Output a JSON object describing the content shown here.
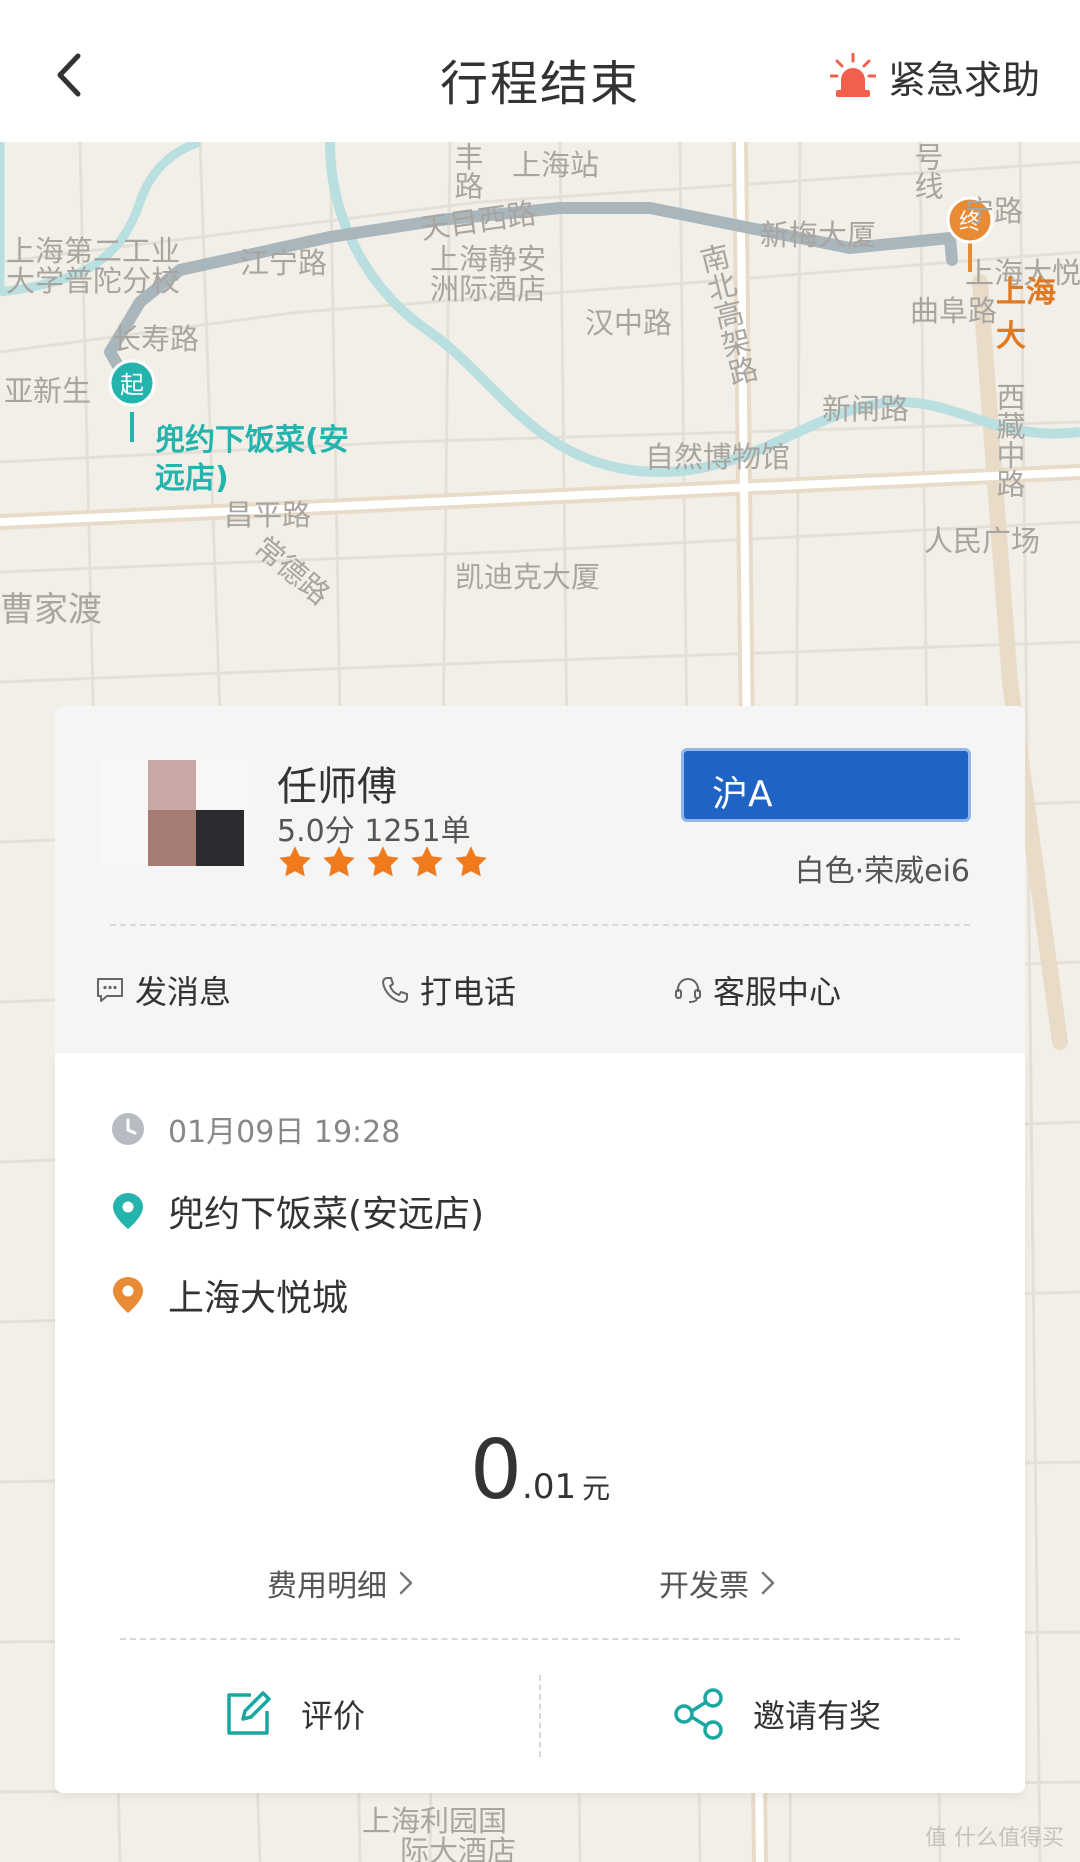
{
  "header": {
    "back_icon": "chevron-left-icon",
    "title": "行程结束",
    "sos_label": "紧急求助",
    "sos_icon": "alarm-light-icon",
    "sos_color": "#f25f4c"
  },
  "map": {
    "start_marker_glyph": "起",
    "end_marker_glyph": "终",
    "start_poi": [
      "兜约下饭菜(安",
      "远店)"
    ],
    "end_poi": "上海大",
    "start_color": "#24b4ad",
    "end_color": "#e98b34",
    "route_color": "#a9b7bd",
    "labels": {
      "l1": "上海第二工业",
      "l2": "大学普陀分校",
      "l3": "江宁路",
      "l4": "天目西路",
      "l5": "上海静安",
      "l6": "洲际酒店",
      "l7": "新梅大厦",
      "l8": "长寿路",
      "l9": "亚新生",
      "l10": "汉中路",
      "l11": "南北高架路",
      "l12": "曲阜路",
      "l13": "新闸路",
      "l14": "自然博物馆",
      "l15": "西藏中路",
      "l16": "人民广场",
      "l17": "昌平路",
      "l18": "常德路",
      "l19": "凯迪克大厦",
      "l20": "曹家渡",
      "l21": "上海利园国",
      "l22": "际大酒店",
      "l23": "宁路",
      "l24": "上海大悦",
      "l25": "号线",
      "l26": "丰路",
      "l27": "上海站"
    }
  },
  "driver": {
    "name": "任师傅",
    "stats": "5.0分 1251单",
    "rating": 5,
    "star_color": "#f07a1e",
    "plate": "沪A",
    "plate_color": "#1f64c4",
    "car": "白色·荣威ei6"
  },
  "actions": {
    "message": "发消息",
    "message_icon": "chat-bubble-icon",
    "call": "打电话",
    "call_icon": "phone-icon",
    "service": "客服中心",
    "service_icon": "headset-icon"
  },
  "trip": {
    "time": "01月09日 19:28",
    "time_icon": "clock-icon",
    "start": "兜约下饭菜(安远店)",
    "end": "上海大悦城"
  },
  "fare": {
    "integer": "0",
    "decimal": ".01",
    "unit": "元",
    "details_label": "费用明细",
    "invoice_label": "开发票"
  },
  "footer": {
    "rate_label": "评价",
    "rate_icon": "edit-icon",
    "invite_label": "邀请有奖",
    "invite_icon": "share-icon",
    "accent": "#1aa7a1"
  },
  "watermark": "值 什么值得买"
}
